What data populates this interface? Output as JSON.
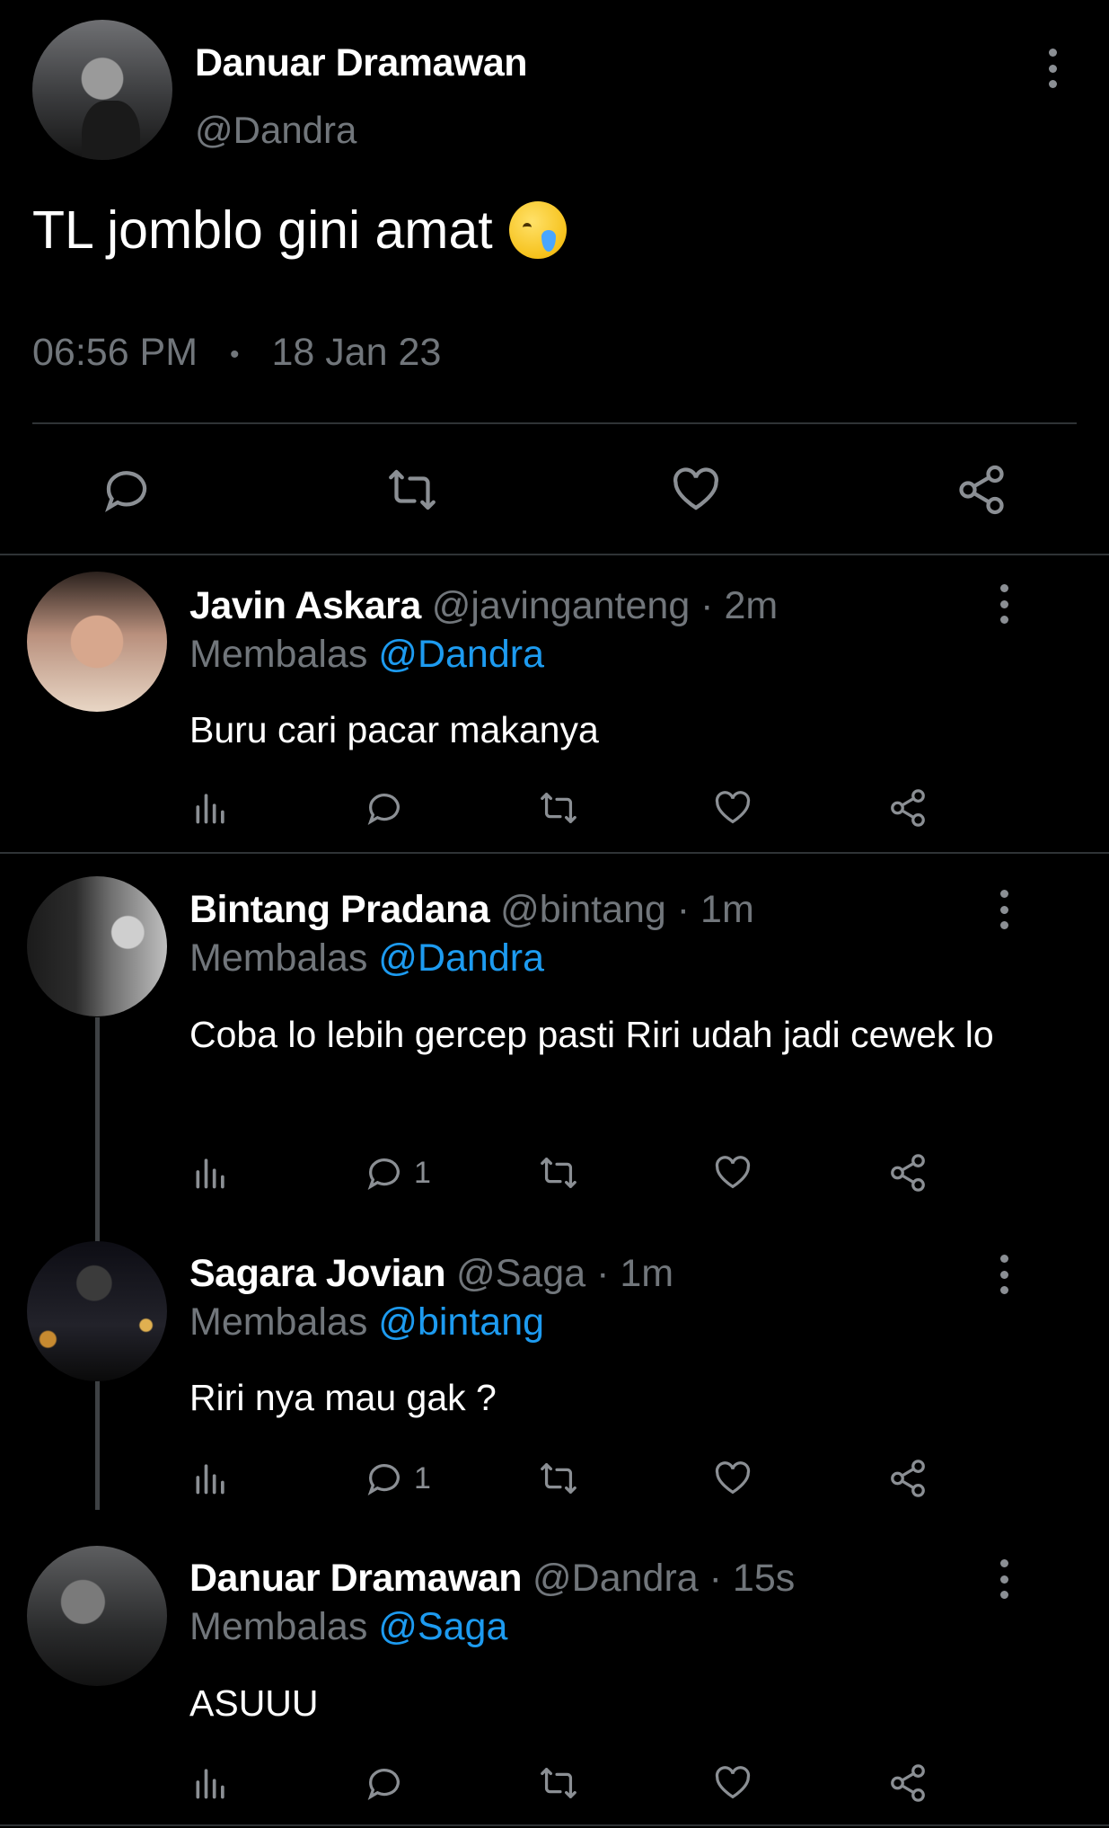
{
  "main_tweet": {
    "name": "Danuar Dramawan",
    "handle": "@Dandra",
    "text": "TL jomblo gini amat",
    "emoji": "face-holding-back-tears",
    "time": "06:56 PM",
    "separator": "•",
    "date": "18 Jan 23",
    "actions": [
      "reply-icon",
      "retweet-icon",
      "like-icon",
      "share-icon"
    ]
  },
  "replies": [
    {
      "name": "Javin Askara",
      "meta": " @javinganteng · 2m",
      "replying_label": "Membalas ",
      "replying_to": "@Dandra",
      "text": "Buru cari pacar makanya",
      "reply_count": ""
    },
    {
      "name": "Bintang Pradana",
      "meta": " @bintang · 1m",
      "replying_label": "Membalas ",
      "replying_to": "@Dandra",
      "text": "Coba lo lebih gercep pasti Riri udah jadi cewek lo",
      "reply_count": "1"
    },
    {
      "name": "Sagara Jovian",
      "meta": " @Saga · 1m",
      "replying_label": "Membalas ",
      "replying_to": "@bintang",
      "text": "Riri nya mau gak ?",
      "reply_count": "1"
    },
    {
      "name": "Danuar Dramawan",
      "meta": " @Dandra · 15s",
      "replying_label": "Membalas ",
      "replying_to": "@Saga",
      "text": "ASUUU",
      "reply_count": ""
    }
  ],
  "colors": {
    "background": "#000000",
    "text": "#ffffff",
    "secondary": "#71767b",
    "mention": "#1d9bf0",
    "divider": "#2f3336"
  }
}
